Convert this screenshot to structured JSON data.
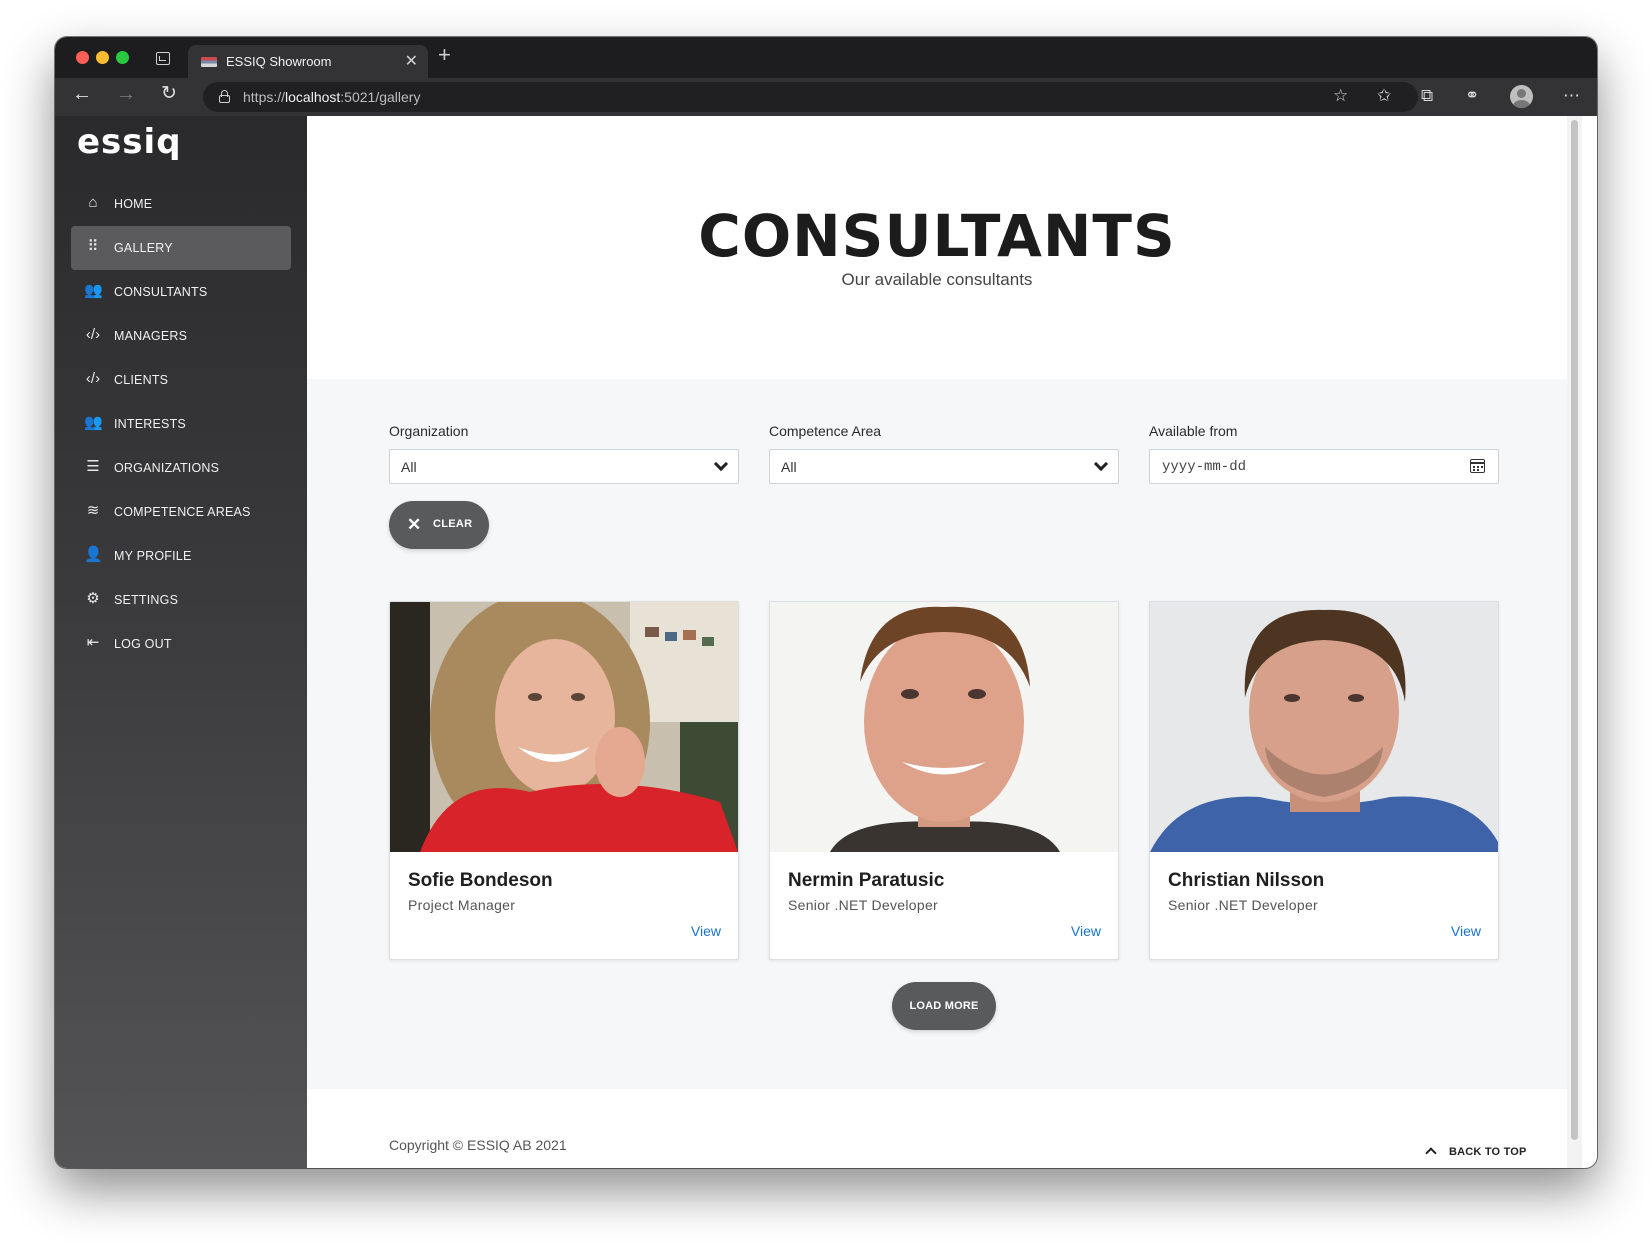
{
  "browser": {
    "tab_title": "ESSIQ Showroom",
    "url_scheme": "https://",
    "url_host": "localhost",
    "url_rest": ":5021/gallery",
    "icons": [
      "back-icon",
      "forward-icon",
      "reload-icon",
      "lock-icon",
      "add-favorite-icon",
      "favorites-icon",
      "collections-icon",
      "extensions-icon",
      "profile-icon",
      "more-icon"
    ]
  },
  "sidebar": {
    "logo": "essiq",
    "items": [
      {
        "label": "HOME",
        "icon": "home-icon",
        "glyph": "⌂"
      },
      {
        "label": "GALLERY",
        "icon": "grid-icon",
        "glyph": "⠿",
        "active": true
      },
      {
        "label": "CONSULTANTS",
        "icon": "people-icon",
        "glyph": "👥"
      },
      {
        "label": "MANAGERS",
        "icon": "code-icon",
        "glyph": "‹/›"
      },
      {
        "label": "CLIENTS",
        "icon": "code-icon",
        "glyph": "‹/›"
      },
      {
        "label": "INTERESTS",
        "icon": "people-icon",
        "glyph": "👥"
      },
      {
        "label": "ORGANIZATIONS",
        "icon": "list-icon",
        "glyph": "☰"
      },
      {
        "label": "COMPETENCE AREAS",
        "icon": "layers-icon",
        "glyph": "≋"
      },
      {
        "label": "MY PROFILE",
        "icon": "person-icon",
        "glyph": "👤"
      },
      {
        "label": "SETTINGS",
        "icon": "gear-icon",
        "glyph": "⚙"
      },
      {
        "label": "LOG OUT",
        "icon": "logout-icon",
        "glyph": "⇤"
      }
    ]
  },
  "hero": {
    "title": "CONSULTANTS",
    "subtitle": "Our available consultants"
  },
  "filters": {
    "organization": {
      "label": "Organization",
      "value": "All"
    },
    "competence_area": {
      "label": "Competence Area",
      "value": "All"
    },
    "available_from": {
      "label": "Available from",
      "placeholder": "yyyy-mm-dd"
    },
    "clear_label": "CLEAR"
  },
  "cards": [
    {
      "name": "Sofie Bondeson",
      "role": "Project Manager",
      "link": "View"
    },
    {
      "name": "Nermin Paratusic",
      "role": "Senior .NET Developer",
      "link": "View"
    },
    {
      "name": "Christian Nilsson",
      "role": "Senior .NET Developer",
      "link": "View"
    }
  ],
  "load_more_label": "LOAD MORE",
  "footer": {
    "copyright": "Copyright © ESSIQ AB 2021",
    "back_to_top": "BACK TO TOP"
  },
  "colors": {
    "sidebar_active": "#5b5b5d",
    "button_bg": "#595a5c",
    "link": "#1a73c8"
  }
}
